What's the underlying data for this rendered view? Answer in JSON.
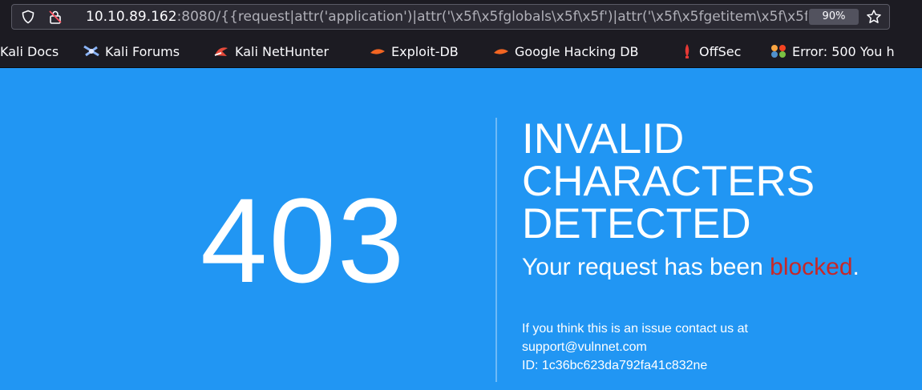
{
  "browser": {
    "url": {
      "host": "10.10.89.162",
      "rest": ":8080/{{request|attr('application')|attr('\\x5f\\x5fglobals\\x5f\\x5f')|attr('\\x5f\\x5fgetitem\\x5f\\x5f')"
    },
    "zoom": "90%",
    "bookmarks": [
      {
        "label": "Kali Docs",
        "icon": "kali-docs-icon"
      },
      {
        "label": "Kali Forums",
        "icon": "kali-forums-icon"
      },
      {
        "label": "Kali NetHunter",
        "icon": "kali-nethunter-icon"
      },
      {
        "label": "Exploit-DB",
        "icon": "exploit-db-icon"
      },
      {
        "label": "Google Hacking DB",
        "icon": "ghdb-icon"
      },
      {
        "label": "OffSec",
        "icon": "offsec-icon"
      },
      {
        "label": "Error: 500 You h",
        "icon": "joomla-icon"
      }
    ]
  },
  "error_page": {
    "code": "403",
    "title_lines": [
      "INVALID",
      "CHARACTERS",
      "DETECTED"
    ],
    "message_prefix": "Your request has been ",
    "message_highlight": "blocked",
    "message_suffix": ".",
    "contact_line": "If you think this is an issue contact us at",
    "contact_email": "support@vulnnet.com",
    "request_id": "ID: 1c36bc623da792fa41c832ne"
  },
  "colors": {
    "page_background": "#2196f3",
    "highlight": "#c62828",
    "toolbar": "#1c1b22"
  }
}
